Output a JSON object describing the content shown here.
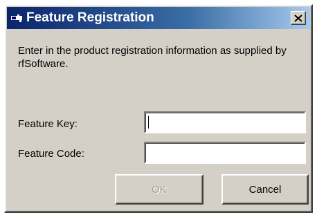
{
  "window": {
    "title": "Feature Registration",
    "title_icon": "key-icon",
    "close_glyph": "✕",
    "colors": {
      "titlebar_start": "#0a246a",
      "titlebar_end": "#a6caf0",
      "face": "#d4d0c8"
    }
  },
  "dialog": {
    "description": "Enter in the product registration information as supplied by rfSoftware.",
    "feature_key_label": "Feature Key:",
    "feature_key_value": "",
    "feature_code_label": "Feature Code:",
    "feature_code_value": "",
    "ok_label": "OK",
    "ok_enabled": false,
    "cancel_label": "Cancel"
  }
}
